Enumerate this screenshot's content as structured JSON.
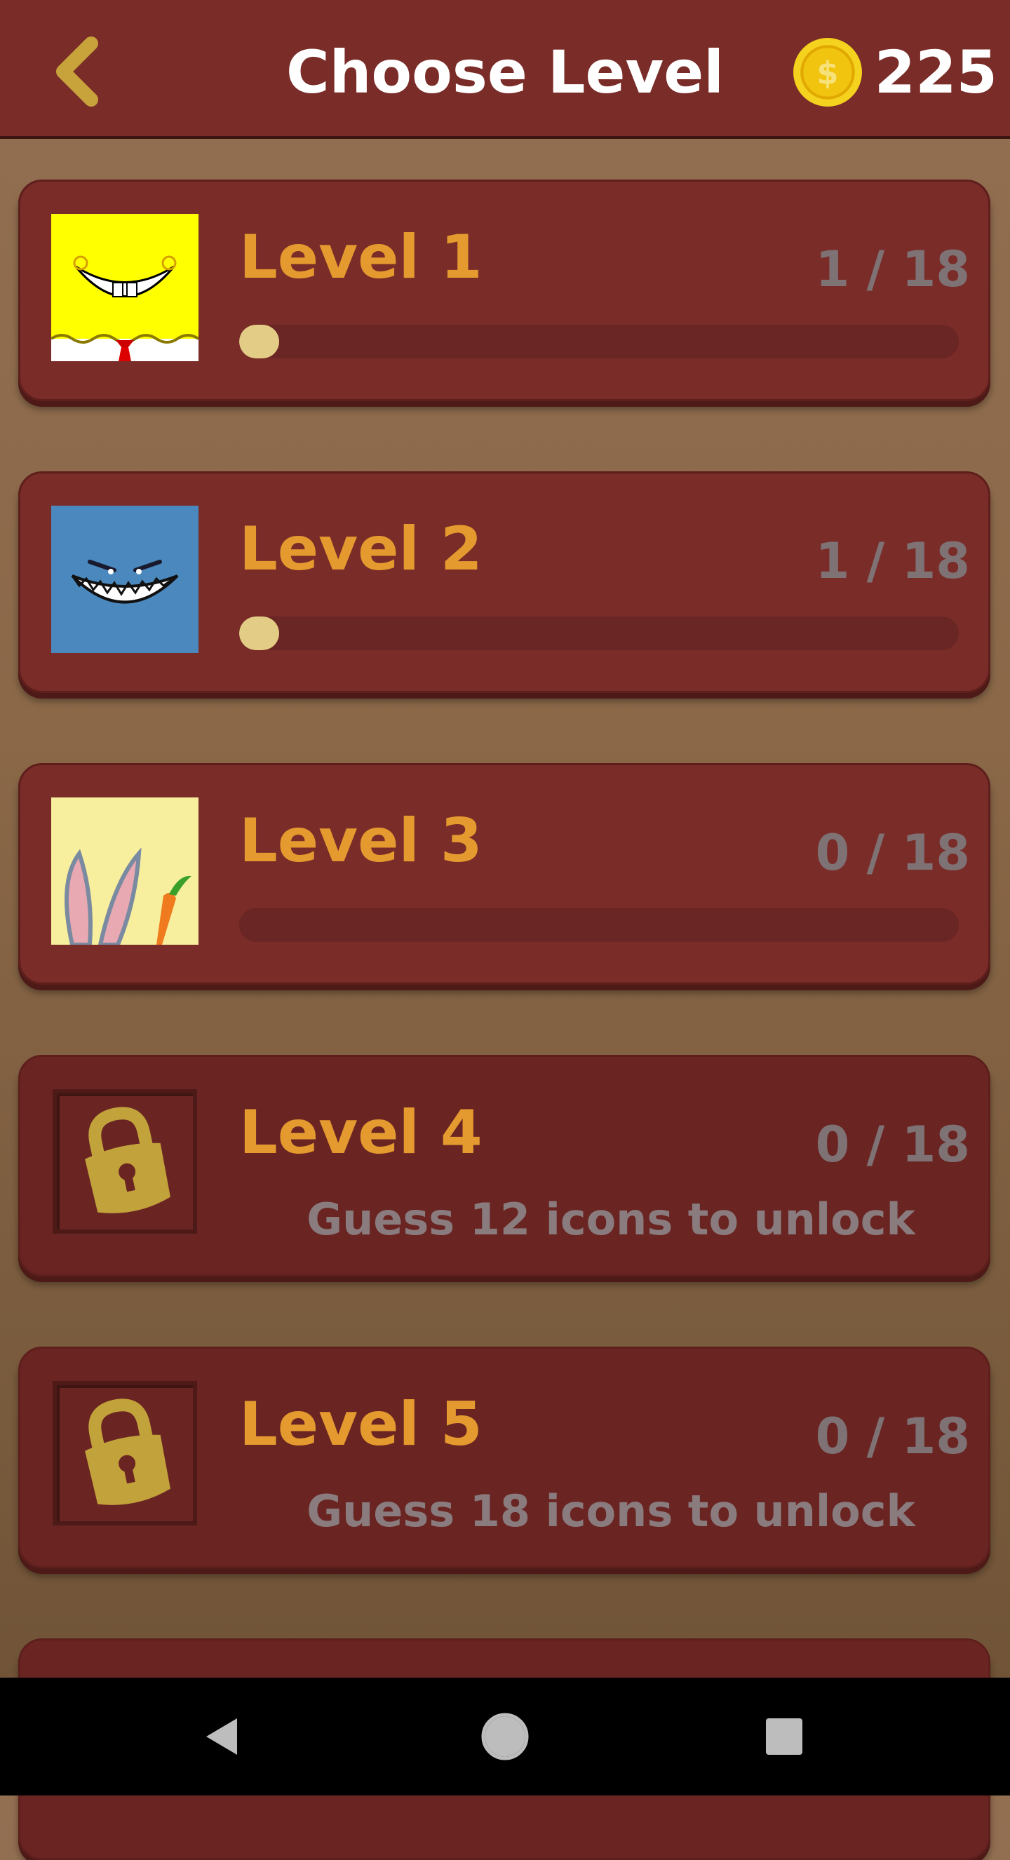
{
  "header": {
    "title": "Choose Level",
    "coins": "225",
    "back_icon": "chevron-left-icon",
    "coin_icon": "dollar-coin-icon"
  },
  "levels": [
    {
      "title": "Level 1",
      "count": "1 / 18",
      "progress": 0.0556,
      "locked": false,
      "image": "yellow-sponge-smile"
    },
    {
      "title": "Level 2",
      "count": "1 / 18",
      "progress": 0.0556,
      "locked": false,
      "image": "blue-shark-grin"
    },
    {
      "title": "Level 3",
      "count": "0 / 18",
      "progress": 0,
      "locked": false,
      "image": "rabbit-ears-carrot"
    },
    {
      "title": "Level 4",
      "count": "0 / 18",
      "locked": true,
      "unlock_text": "Guess 12 icons to unlock",
      "icon": "lock-icon"
    },
    {
      "title": "Level 5",
      "count": "0 / 18",
      "locked": true,
      "unlock_text": "Guess 18 icons to unlock",
      "icon": "lock-icon"
    }
  ],
  "colors": {
    "header_bg": "#7a2c28",
    "card_bg": "#7a2c28",
    "level_title": "#e59a2f",
    "progress_fill": "#e3cd86",
    "coin": "#f5d21e"
  },
  "navbar": [
    "back-triangle-icon",
    "home-circle-icon",
    "recents-square-icon"
  ]
}
